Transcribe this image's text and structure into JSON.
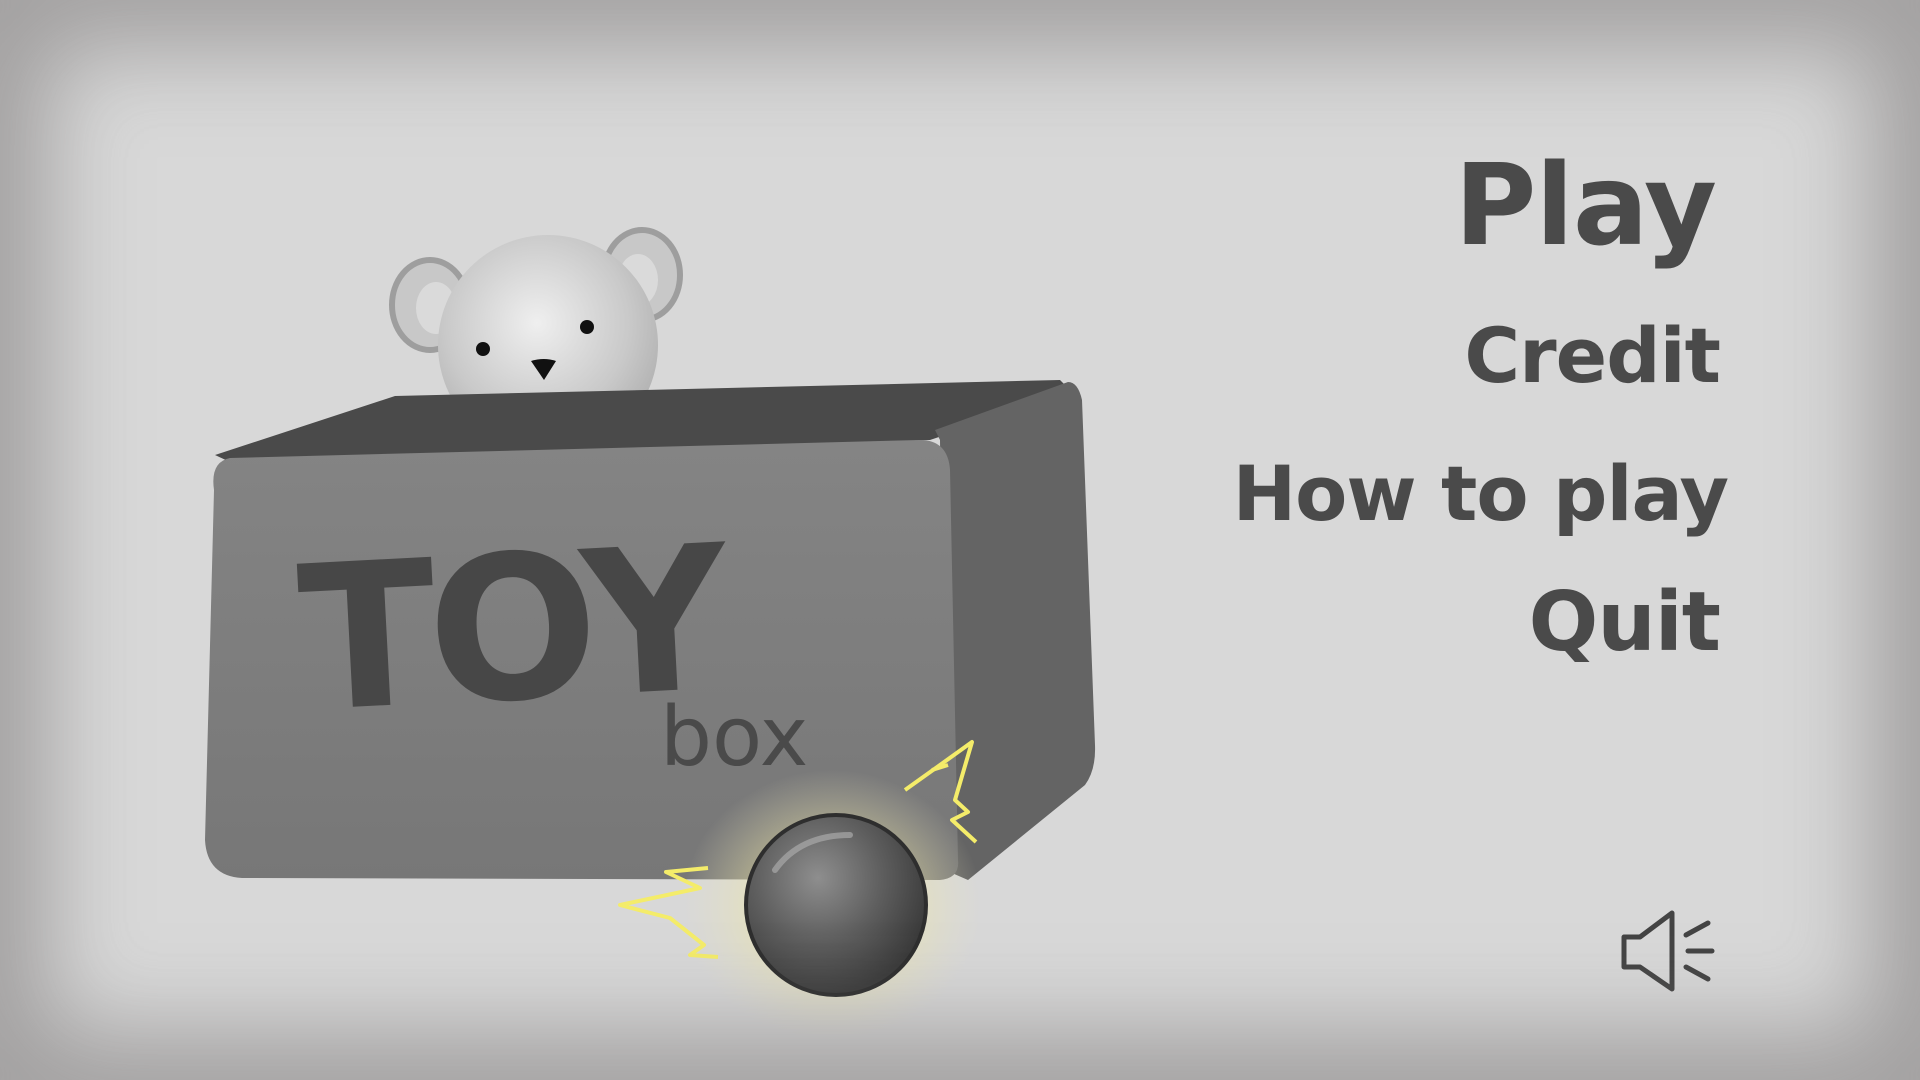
{
  "logo": {
    "title_main": "TOY",
    "title_sub": "box"
  },
  "menu": {
    "play": "Play",
    "credit": "Credit",
    "how_to_play": "How to play",
    "quit": "Quit"
  },
  "icons": {
    "sound": "speaker-icon"
  },
  "colors": {
    "background": "#d8d8d8",
    "box_front": "#7c7c7c",
    "box_side": "#626262",
    "box_inside": "#4d4d4d",
    "menu_text": "#4a4a4a",
    "spark": "#f4ec6a"
  }
}
